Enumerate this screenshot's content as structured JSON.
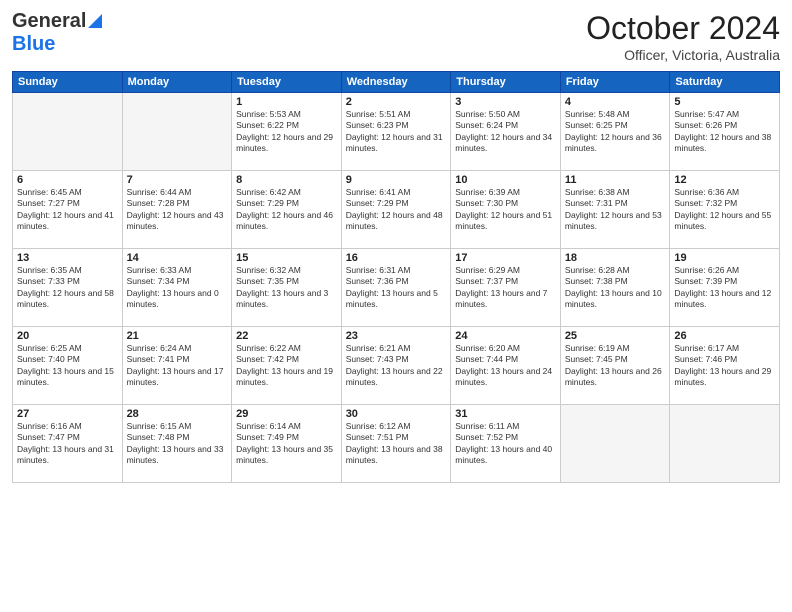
{
  "header": {
    "logo_general": "General",
    "logo_blue": "Blue",
    "month": "October 2024",
    "location": "Officer, Victoria, Australia"
  },
  "days_of_week": [
    "Sunday",
    "Monday",
    "Tuesday",
    "Wednesday",
    "Thursday",
    "Friday",
    "Saturday"
  ],
  "weeks": [
    [
      {
        "day": "",
        "empty": true
      },
      {
        "day": "",
        "empty": true
      },
      {
        "day": "1",
        "sunrise": "5:53 AM",
        "sunset": "6:22 PM",
        "daylight": "12 hours and 29 minutes."
      },
      {
        "day": "2",
        "sunrise": "5:51 AM",
        "sunset": "6:23 PM",
        "daylight": "12 hours and 31 minutes."
      },
      {
        "day": "3",
        "sunrise": "5:50 AM",
        "sunset": "6:24 PM",
        "daylight": "12 hours and 34 minutes."
      },
      {
        "day": "4",
        "sunrise": "5:48 AM",
        "sunset": "6:25 PM",
        "daylight": "12 hours and 36 minutes."
      },
      {
        "day": "5",
        "sunrise": "5:47 AM",
        "sunset": "6:26 PM",
        "daylight": "12 hours and 38 minutes."
      }
    ],
    [
      {
        "day": "6",
        "sunrise": "6:45 AM",
        "sunset": "7:27 PM",
        "daylight": "12 hours and 41 minutes."
      },
      {
        "day": "7",
        "sunrise": "6:44 AM",
        "sunset": "7:28 PM",
        "daylight": "12 hours and 43 minutes."
      },
      {
        "day": "8",
        "sunrise": "6:42 AM",
        "sunset": "7:29 PM",
        "daylight": "12 hours and 46 minutes."
      },
      {
        "day": "9",
        "sunrise": "6:41 AM",
        "sunset": "7:29 PM",
        "daylight": "12 hours and 48 minutes."
      },
      {
        "day": "10",
        "sunrise": "6:39 AM",
        "sunset": "7:30 PM",
        "daylight": "12 hours and 51 minutes."
      },
      {
        "day": "11",
        "sunrise": "6:38 AM",
        "sunset": "7:31 PM",
        "daylight": "12 hours and 53 minutes."
      },
      {
        "day": "12",
        "sunrise": "6:36 AM",
        "sunset": "7:32 PM",
        "daylight": "12 hours and 55 minutes."
      }
    ],
    [
      {
        "day": "13",
        "sunrise": "6:35 AM",
        "sunset": "7:33 PM",
        "daylight": "12 hours and 58 minutes."
      },
      {
        "day": "14",
        "sunrise": "6:33 AM",
        "sunset": "7:34 PM",
        "daylight": "13 hours and 0 minutes."
      },
      {
        "day": "15",
        "sunrise": "6:32 AM",
        "sunset": "7:35 PM",
        "daylight": "13 hours and 3 minutes."
      },
      {
        "day": "16",
        "sunrise": "6:31 AM",
        "sunset": "7:36 PM",
        "daylight": "13 hours and 5 minutes."
      },
      {
        "day": "17",
        "sunrise": "6:29 AM",
        "sunset": "7:37 PM",
        "daylight": "13 hours and 7 minutes."
      },
      {
        "day": "18",
        "sunrise": "6:28 AM",
        "sunset": "7:38 PM",
        "daylight": "13 hours and 10 minutes."
      },
      {
        "day": "19",
        "sunrise": "6:26 AM",
        "sunset": "7:39 PM",
        "daylight": "13 hours and 12 minutes."
      }
    ],
    [
      {
        "day": "20",
        "sunrise": "6:25 AM",
        "sunset": "7:40 PM",
        "daylight": "13 hours and 15 minutes."
      },
      {
        "day": "21",
        "sunrise": "6:24 AM",
        "sunset": "7:41 PM",
        "daylight": "13 hours and 17 minutes."
      },
      {
        "day": "22",
        "sunrise": "6:22 AM",
        "sunset": "7:42 PM",
        "daylight": "13 hours and 19 minutes."
      },
      {
        "day": "23",
        "sunrise": "6:21 AM",
        "sunset": "7:43 PM",
        "daylight": "13 hours and 22 minutes."
      },
      {
        "day": "24",
        "sunrise": "6:20 AM",
        "sunset": "7:44 PM",
        "daylight": "13 hours and 24 minutes."
      },
      {
        "day": "25",
        "sunrise": "6:19 AM",
        "sunset": "7:45 PM",
        "daylight": "13 hours and 26 minutes."
      },
      {
        "day": "26",
        "sunrise": "6:17 AM",
        "sunset": "7:46 PM",
        "daylight": "13 hours and 29 minutes."
      }
    ],
    [
      {
        "day": "27",
        "sunrise": "6:16 AM",
        "sunset": "7:47 PM",
        "daylight": "13 hours and 31 minutes."
      },
      {
        "day": "28",
        "sunrise": "6:15 AM",
        "sunset": "7:48 PM",
        "daylight": "13 hours and 33 minutes."
      },
      {
        "day": "29",
        "sunrise": "6:14 AM",
        "sunset": "7:49 PM",
        "daylight": "13 hours and 35 minutes."
      },
      {
        "day": "30",
        "sunrise": "6:12 AM",
        "sunset": "7:51 PM",
        "daylight": "13 hours and 38 minutes."
      },
      {
        "day": "31",
        "sunrise": "6:11 AM",
        "sunset": "7:52 PM",
        "daylight": "13 hours and 40 minutes."
      },
      {
        "day": "",
        "empty": true
      },
      {
        "day": "",
        "empty": true
      }
    ]
  ]
}
